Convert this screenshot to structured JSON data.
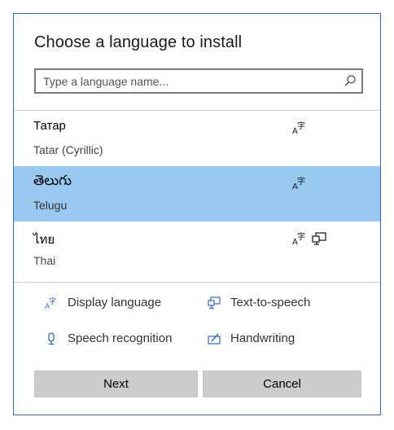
{
  "dialog": {
    "title": "Choose a language to install",
    "search": {
      "placeholder": "Type a language name...",
      "value": ""
    },
    "languages": [
      {
        "native": "Татар",
        "english": "Tatar (Cyrillic)",
        "selected": false,
        "capabilities": [
          "display-language-icon"
        ]
      },
      {
        "native": "తెలుగు",
        "english": "Telugu",
        "selected": true,
        "capabilities": [
          "display-language-icon"
        ]
      },
      {
        "native": "ไทย",
        "english": "Thai",
        "selected": false,
        "capabilities": [
          "display-language-icon",
          "text-to-speech-icon"
        ]
      }
    ],
    "legend": {
      "display_language": "Display language",
      "text_to_speech": "Text-to-speech",
      "speech_recognition": "Speech recognition",
      "handwriting": "Handwriting"
    },
    "buttons": {
      "next": "Next",
      "cancel": "Cancel"
    }
  },
  "colors": {
    "border": "#2b6cc4",
    "selected_row": "#99c8f0",
    "icon_blue": "#2b6cc4",
    "button_bg": "#cccccc"
  }
}
